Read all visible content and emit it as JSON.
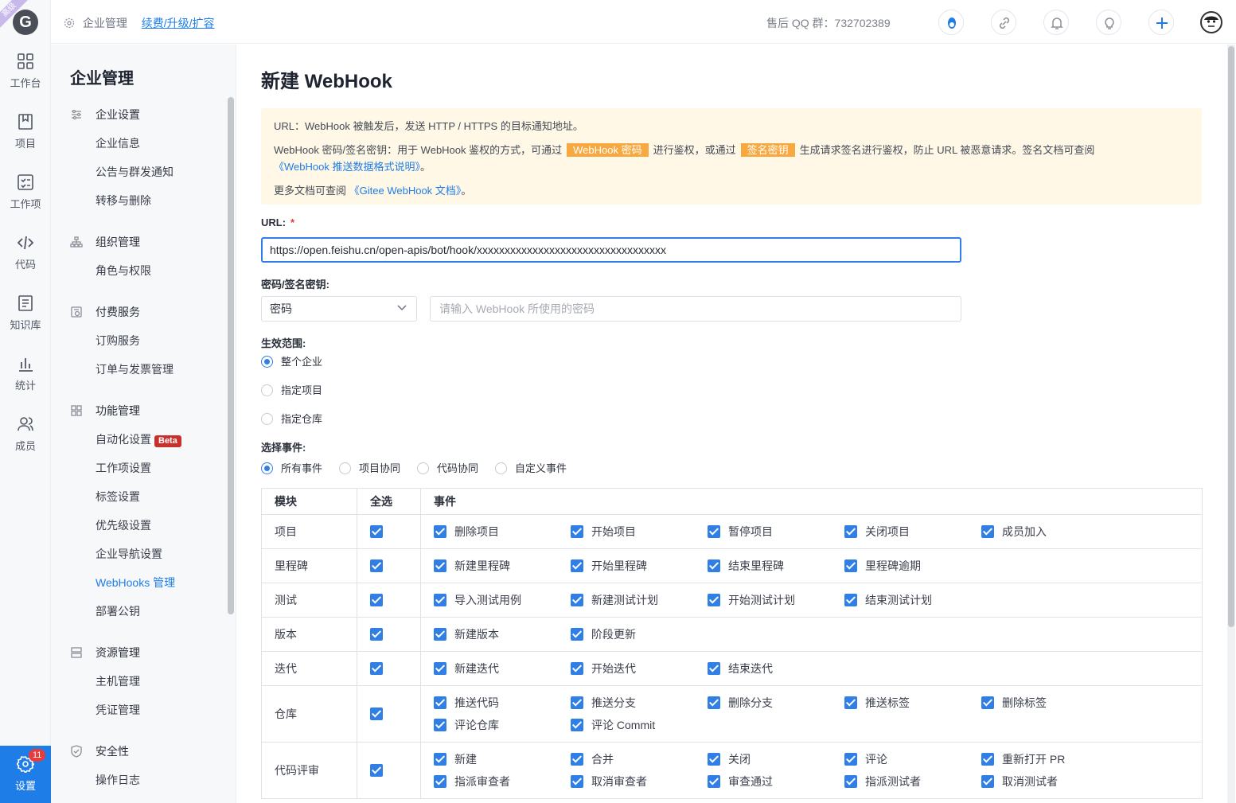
{
  "rail": {
    "ribbon": "高级",
    "logo_letter": "G",
    "items": [
      {
        "label": "工作台",
        "icon": "dashboard-icon"
      },
      {
        "label": "项目",
        "icon": "book-icon"
      },
      {
        "label": "工作项",
        "icon": "checklist-icon"
      },
      {
        "label": "代码",
        "icon": "code-icon"
      },
      {
        "label": "知识库",
        "icon": "document-icon"
      },
      {
        "label": "统计",
        "icon": "bar-chart-icon"
      },
      {
        "label": "成员",
        "icon": "members-icon"
      }
    ],
    "settings": {
      "label": "设置",
      "badge": "11",
      "icon": "gear-icon"
    }
  },
  "topbar": {
    "breadcrumb": "企业管理",
    "upgrade_link": "续费/升级/扩容",
    "qq_group": "售后 QQ 群：732702389",
    "icons": [
      "qq-icon",
      "link-icon",
      "bell-icon",
      "lightbulb-icon",
      "plus-icon"
    ]
  },
  "menu": {
    "title": "企业管理",
    "groups": [
      {
        "label": "企业设置",
        "items": [
          "企业信息",
          "公告与群发通知",
          "转移与删除"
        ]
      },
      {
        "label": "组织管理",
        "items": [
          "角色与权限"
        ]
      },
      {
        "label": "付费服务",
        "items": [
          "订购服务",
          "订单与发票管理"
        ]
      },
      {
        "label": "功能管理",
        "items": [
          "自动化设置",
          "工作项设置",
          "标签设置",
          "优先级设置",
          "企业导航设置",
          "WebHooks 管理",
          "部署公钥"
        ]
      },
      {
        "label": "资源管理",
        "items": [
          "主机管理",
          "凭证管理"
        ]
      },
      {
        "label": "安全性",
        "items": [
          "操作日志"
        ]
      }
    ],
    "beta_label": "Beta",
    "active_item": "WebHooks 管理"
  },
  "main": {
    "title": "新建 WebHook",
    "notice": {
      "line1": "URL：WebHook 被触发后，发送 HTTP / HTTPS 的目标通知地址。",
      "line2_a": "WebHook 密码/签名密钥：用于 WebHook 鉴权的方式，可通过",
      "hl1": "WebHook 密码",
      "line2_b": "进行鉴权，或通过",
      "hl2": "签名密钥",
      "line2_c": "生成请求签名进行鉴权，防止 URL 被恶意请求。签名文档可查阅",
      "link1": "《WebHook 推送数据格式说明》",
      "end1": "。",
      "line3_a": "更多文档可查阅",
      "link2": "《Gitee WebHook 文档》",
      "end2": "。"
    },
    "url_label": "URL:",
    "url_required": "*",
    "url_value": "https://open.feishu.cn/open-apis/bot/hook/xxxxxxxxxxxxxxxxxxxxxxxxxxxxxxxxxx",
    "secret_label": "密码/签名密钥:",
    "secret_type": "密码",
    "secret_placeholder": "请输入 WebHook 所使用的密码",
    "scope_label": "生效范围:",
    "scope_options": [
      "整个企业",
      "指定项目",
      "指定仓库"
    ],
    "scope_selected": "整个企业",
    "events_label": "选择事件:",
    "event_options": [
      "所有事件",
      "项目协同",
      "代码协同",
      "自定义事件"
    ],
    "event_selected": "所有事件",
    "table": {
      "headers": [
        "模块",
        "全选",
        "事件"
      ],
      "rows": [
        {
          "module": "项目",
          "events": [
            "删除项目",
            "开始项目",
            "暂停项目",
            "关闭项目",
            "成员加入"
          ]
        },
        {
          "module": "里程碑",
          "events": [
            "新建里程碑",
            "开始里程碑",
            "结束里程碑",
            "里程碑逾期"
          ]
        },
        {
          "module": "测试",
          "events": [
            "导入测试用例",
            "新建测试计划",
            "开始测试计划",
            "结束测试计划"
          ]
        },
        {
          "module": "版本",
          "events": [
            "新建版本",
            "阶段更新"
          ]
        },
        {
          "module": "迭代",
          "events": [
            "新建迭代",
            "开始迭代",
            "结束迭代"
          ]
        },
        {
          "module": "仓库",
          "events": [
            "推送代码",
            "推送分支",
            "删除分支",
            "推送标签",
            "删除标签",
            "评论仓库",
            "评论 Commit"
          ]
        },
        {
          "module": "代码评审",
          "events": [
            "新建",
            "合并",
            "关闭",
            "评论",
            "重新打开 PR",
            "指派审查者",
            "取消审查者",
            "审查通过",
            "指派测试者",
            "取消测试者"
          ]
        }
      ]
    }
  }
}
